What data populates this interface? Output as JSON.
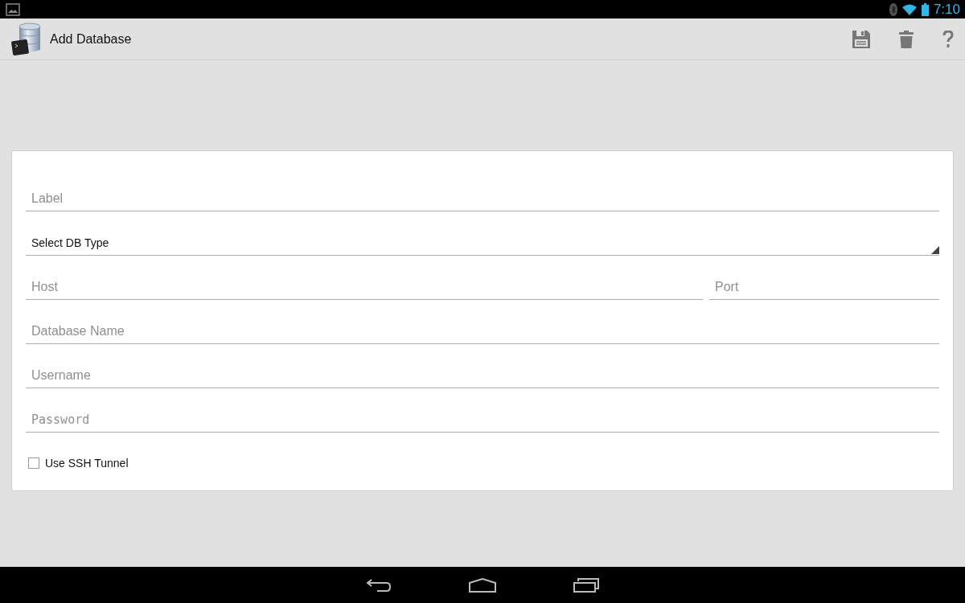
{
  "status_bar": {
    "time": "7:10"
  },
  "action_bar": {
    "title": "Add Database"
  },
  "form": {
    "rows": [
      [
        {
          "kind": "text",
          "placeholder": "Label"
        }
      ],
      [
        {
          "kind": "select",
          "value": "Select DB Type"
        }
      ],
      [
        {
          "kind": "text",
          "placeholder": "Host"
        },
        {
          "kind": "text",
          "placeholder": "Port"
        }
      ],
      [
        {
          "kind": "text",
          "placeholder": "Database Name"
        }
      ],
      [
        {
          "kind": "text",
          "placeholder": "Username"
        }
      ],
      [
        {
          "kind": "password",
          "placeholder": "Password"
        }
      ]
    ],
    "checkbox": {
      "label": "Use SSH Tunnel",
      "checked": false
    }
  }
}
